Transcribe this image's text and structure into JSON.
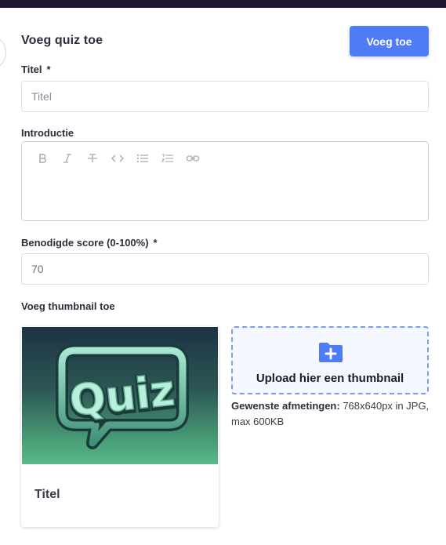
{
  "header": {
    "title": "Voeg quiz toe",
    "add_button": "Voeg toe"
  },
  "form": {
    "title_label": "Titel",
    "title_required": "*",
    "title_placeholder": "Titel",
    "intro_label": "Introductie",
    "editor_toolbar": [
      "bold-icon",
      "italic-icon",
      "strikethrough-icon",
      "code-icon",
      "bullet-list-icon",
      "numbered-list-icon",
      "link-icon"
    ],
    "score_label": "Benodigde score (0-100%)",
    "score_required": "*",
    "score_value": "70",
    "thumbnail_label": "Voeg thumbnail toe"
  },
  "preview_card": {
    "image_text": "Quiz",
    "title": "Titel"
  },
  "upload": {
    "icon": "folder-plus-icon",
    "label": "Upload hier een thumbnail",
    "hint_bold": "Gewenste afmetingen:",
    "hint_text": " 768x640px in JPG, max 600KB"
  },
  "colors": {
    "accent": "#4f7bf7",
    "topbar": "#1e1633",
    "upload_border": "#7c9cf3"
  }
}
